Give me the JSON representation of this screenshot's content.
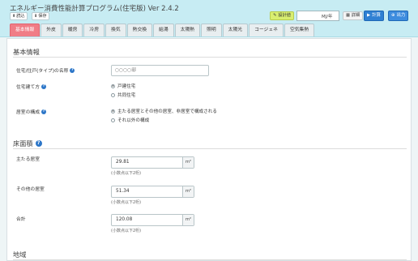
{
  "app": {
    "title": "エネルギー消費性能計算プログラム(住宅版) Ver 2.4.2"
  },
  "toolbar": {
    "load_label": "読込",
    "save_label": "保存",
    "calc_tag_label": "設計値",
    "result_value": "",
    "unit_label": "MJ/年",
    "detail_label": "詳細",
    "calc_button_label": "計算",
    "output_button_label": "出力"
  },
  "tabs": [
    {
      "label": "基本情報",
      "active": true
    },
    {
      "label": "外皮"
    },
    {
      "label": "暖房"
    },
    {
      "label": "冷房"
    },
    {
      "label": "換気"
    },
    {
      "label": "熱交換"
    },
    {
      "label": "給湯"
    },
    {
      "label": "太陽熱"
    },
    {
      "label": "照明"
    },
    {
      "label": "太陽光"
    },
    {
      "label": "コージェネ"
    },
    {
      "label": "空気集熱"
    }
  ],
  "basic_info": {
    "section_title": "基本情報",
    "name_label": "住宅/住戸(タイプ)の名称",
    "name_placeholder": "○○○○邸",
    "house_type_label": "住宅建て方",
    "house_type_options": [
      "戸建住宅",
      "共同住宅"
    ],
    "house_type_selected": 0,
    "structure_label": "居室の構成",
    "structure_options": [
      "主たる居室とその他の居室、非居室で構成される",
      "それ以外の構成"
    ],
    "structure_selected": 0
  },
  "floor_area": {
    "section_title": "床面積",
    "unit": "m²",
    "hint": "(小数点以下2桁)",
    "main_label": "主たる居室",
    "main_value": "29.81",
    "other_label": "その他の居室",
    "other_value": "51.34",
    "total_label": "合計",
    "total_value": "120.08"
  },
  "region": {
    "section_title": "地域"
  },
  "colors": {
    "topbar": "#c7ecf3",
    "active_tab": "#f07d86",
    "primary_button": "#2f80d3",
    "calc_tag": "#d9ee71"
  }
}
